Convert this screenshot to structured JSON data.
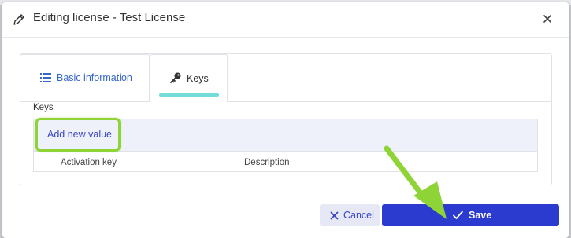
{
  "dialog": {
    "title": "Editing license - Test License",
    "icons": {
      "title_icon": "pencil-icon",
      "close_icon": "close-icon"
    }
  },
  "tabs": [
    {
      "label": "Basic information",
      "icon": "list-icon",
      "active": false
    },
    {
      "label": "Keys",
      "icon": "key-icon",
      "active": true
    }
  ],
  "keys_section": {
    "label": "Keys",
    "add_new_label": "Add new value",
    "columns": [
      "Activation key",
      "Description"
    ]
  },
  "footer": {
    "cancel_label": "Cancel",
    "save_label": "Save"
  },
  "colors": {
    "accent": "#2b3bcf",
    "link": "#3a47c8",
    "tab_indicator": "#73dbd8",
    "highlight": "#8fd437"
  }
}
